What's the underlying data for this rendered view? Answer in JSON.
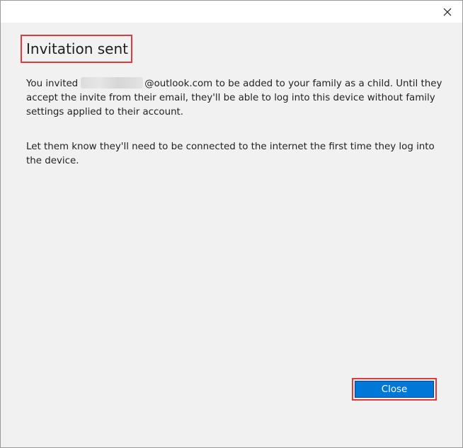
{
  "dialog": {
    "heading": "Invitation sent",
    "paragraph1_before": "You invited",
    "paragraph1_after": "@outlook.com to be added to your family as a child. Until they accept the invite from their email, they'll be able to log into this device without family settings applied to their account.",
    "paragraph2": "Let them know they'll need to be connected to the internet the first time they log into the device.",
    "close_button_label": "Close"
  },
  "titlebar": {
    "close_icon": "close-icon"
  },
  "colors": {
    "accent": "#0078d7",
    "highlight_border": "#e0393e",
    "background": "#f2f1f1"
  }
}
